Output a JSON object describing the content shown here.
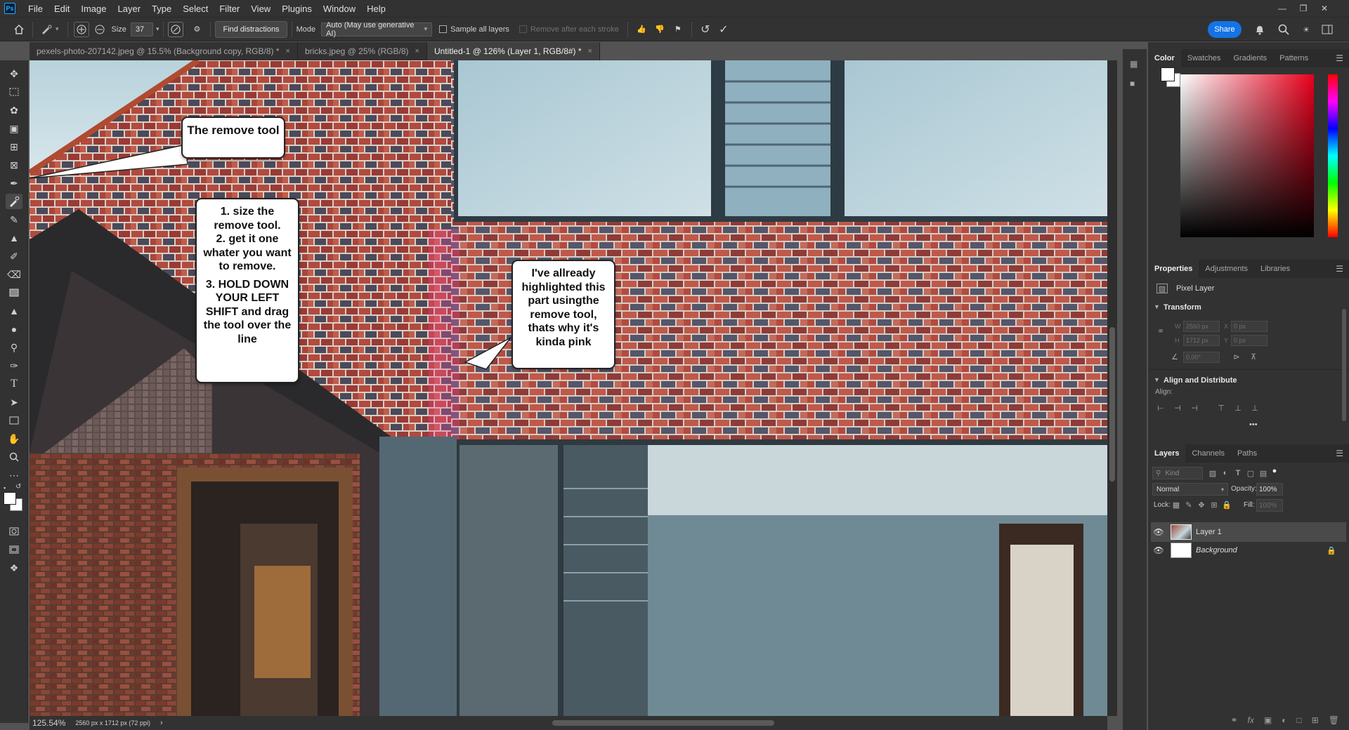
{
  "menubar": {
    "app_logo": "Ps",
    "items": [
      "File",
      "Edit",
      "Image",
      "Layer",
      "Type",
      "Select",
      "Filter",
      "View",
      "Plugins",
      "Window",
      "Help"
    ]
  },
  "options": {
    "size_label": "Size",
    "size_value": "37",
    "find_distractions": "Find distractions",
    "mode_label": "Mode",
    "mode_value": "Auto (May use generative AI)",
    "sample_all_layers": "Sample all layers",
    "remove_after_stroke": "Remove after each stroke",
    "share": "Share"
  },
  "tabs": [
    {
      "label": "pexels-photo-207142.jpeg @ 15.5% (Background copy, RGB/8) *",
      "close": "×"
    },
    {
      "label": "bricks.jpeg @ 25% (RGB/8)",
      "close": "×"
    },
    {
      "label": "Untitled-1 @ 126% (Layer 1, RGB/8#) *",
      "close": "×"
    }
  ],
  "annotations": {
    "remove_tool": "The remove tool",
    "steps_1": "1. size the remove tool.",
    "steps_2": "2. get it one whater  you want to remove.",
    "steps_3": "3. HOLD DOWN YOUR LEFT SHIFT and drag the tool over the line",
    "highlight": "I've allready highlighted this part usingthe remove tool, thats why it's kinda pink"
  },
  "status": {
    "zoom": "125.54%",
    "doc_info": "2560 px x 1712 px (72 ppi)",
    "arrow": "›"
  },
  "color_panel": {
    "tabs": [
      "Color",
      "Swatches",
      "Gradients",
      "Patterns"
    ],
    "active": "Color"
  },
  "properties_panel": {
    "tabs": [
      "Properties",
      "Adjustments",
      "Libraries"
    ],
    "layer_type": "Pixel Layer",
    "transform_title": "Transform",
    "w_label": "W",
    "w_value": "2560 px",
    "h_label": "H",
    "h_value": "1712 px",
    "x_label": "X",
    "x_value": "0 px",
    "y_label": "Y",
    "y_value": "0 px",
    "angle_value": "0.00°",
    "align_title": "Align and Distribute",
    "align_label": "Align:",
    "more": "•••"
  },
  "layers_panel": {
    "tabs": [
      "Layers",
      "Channels",
      "Paths"
    ],
    "kind_placeholder": "Kind",
    "blend_mode": "Normal",
    "opacity_label": "Opacity:",
    "opacity_value": "100%",
    "lock_label": "Lock:",
    "fill_label": "Fill:",
    "fill_value": "100%",
    "layers": [
      {
        "name": "Layer 1",
        "selected": true
      },
      {
        "name": "Background",
        "selected": false,
        "locked": true
      }
    ]
  },
  "colors": {
    "accent": "#1473e6",
    "brick": "#a9463b",
    "sky": "#c9dde4"
  }
}
